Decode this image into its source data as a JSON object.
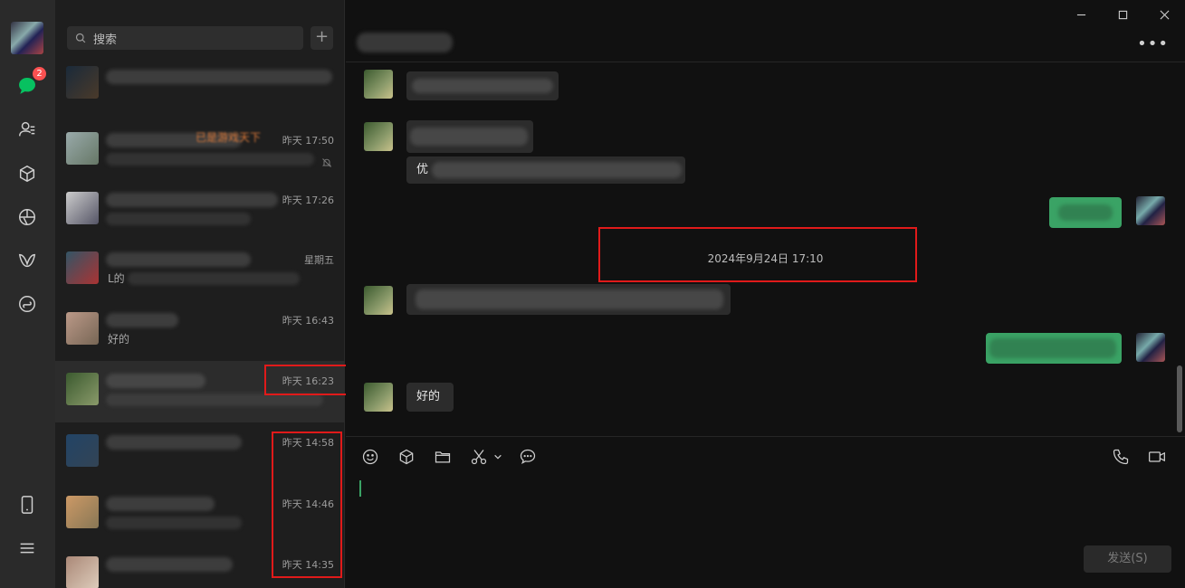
{
  "nav": {
    "unread_badge": "2",
    "items": [
      "chats-icon",
      "contacts-icon",
      "favorites-icon",
      "moments-icon",
      "channels-icon",
      "mini-programs-icon"
    ]
  },
  "search": {
    "placeholder": "搜索",
    "add_label": "+"
  },
  "conversations": [
    {
      "time": "",
      "preview": "",
      "highlight": ""
    },
    {
      "time": "昨天 17:50",
      "preview": "",
      "highlight": "已是游戏天下"
    },
    {
      "time": "昨天 17:26",
      "preview": "",
      "highlight": ""
    },
    {
      "time": "星期五",
      "preview": "L的",
      "highlight": ""
    },
    {
      "time": "昨天 16:43",
      "preview": "好的",
      "highlight": ""
    },
    {
      "time": "昨天 16:23",
      "preview": "",
      "highlight": ""
    },
    {
      "time": "昨天 14:58",
      "preview": "",
      "highlight": ""
    },
    {
      "time": "昨天 14:46",
      "preview": "",
      "highlight": ""
    },
    {
      "time": "昨天 14:35",
      "preview": "",
      "highlight": ""
    }
  ],
  "chat": {
    "separator_time": "2024年9月24日 17:10",
    "message_partial": "优",
    "last_message": "好的",
    "send_label": "发送(S)",
    "more_label": "•••"
  },
  "colors": {
    "accent_green": "#3aa365",
    "badge_red": "#fa5151",
    "annotation_red": "#e01a1a"
  }
}
